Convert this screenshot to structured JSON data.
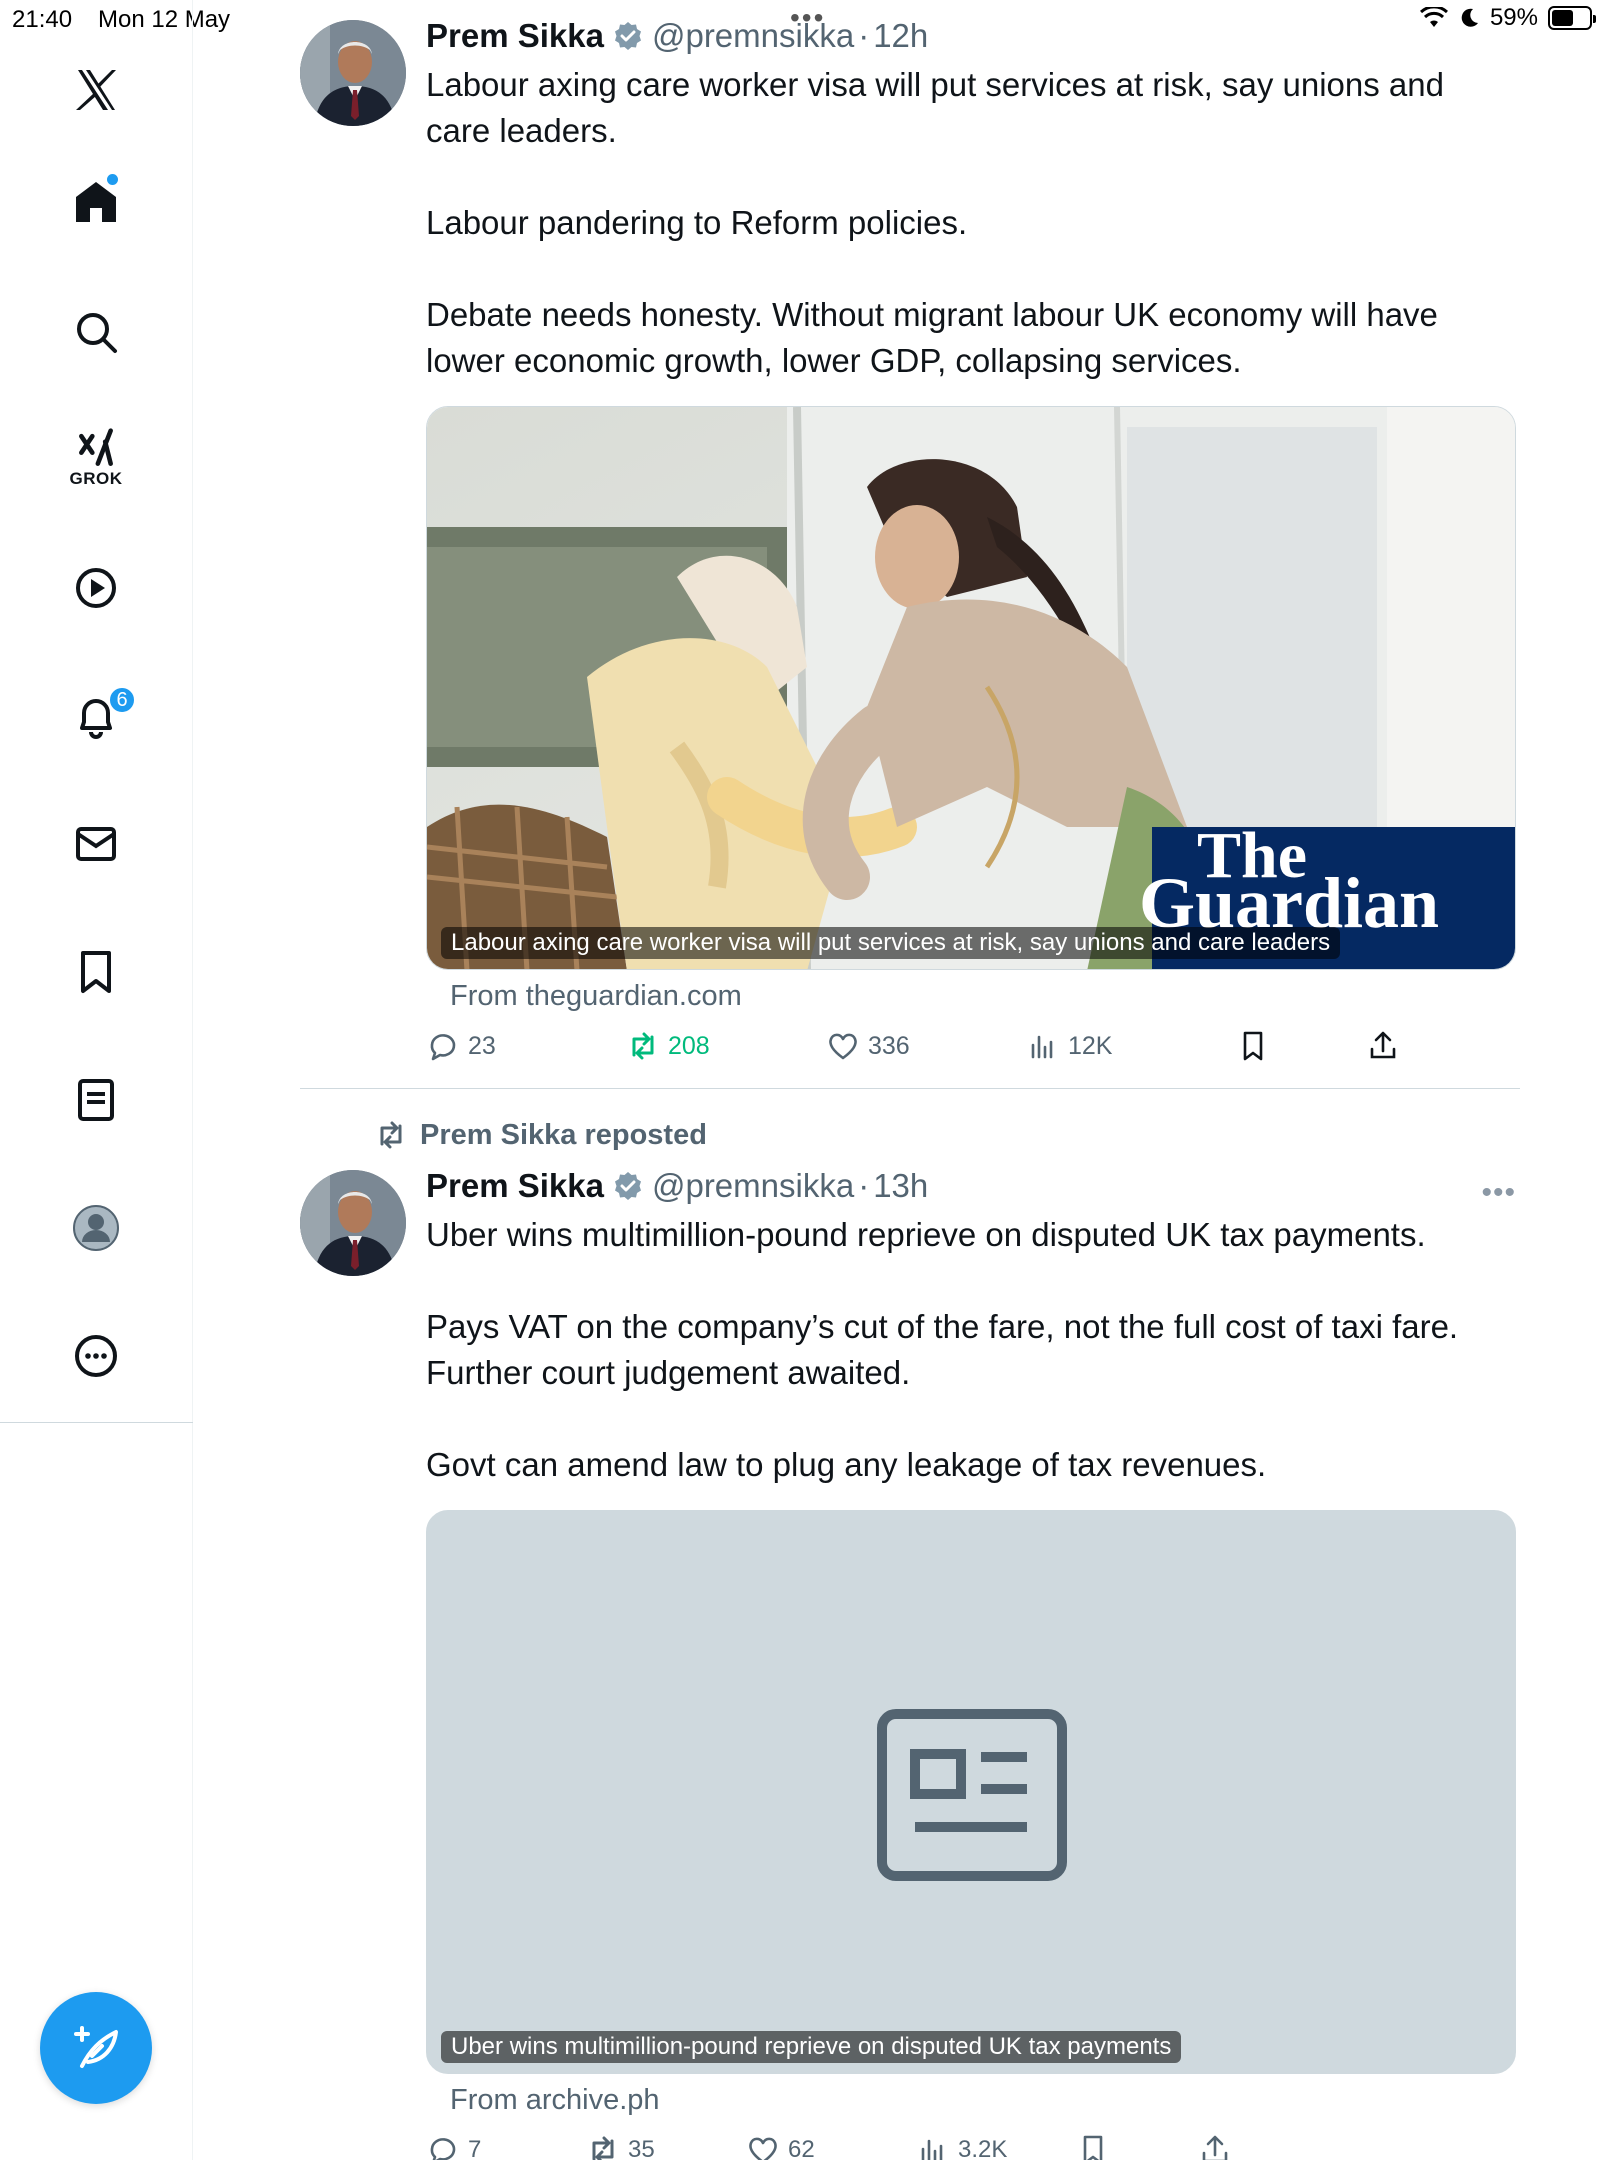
{
  "status_bar": {
    "time": "21:40",
    "date": "Mon 12 May",
    "battery": "59%",
    "battery_level": 0.59
  },
  "sidebar": {
    "grok_label": "GROK",
    "notifications_badge": "6",
    "items": [
      {
        "name": "x-logo",
        "icon": "x-logo-icon"
      },
      {
        "name": "home",
        "icon": "home-icon"
      },
      {
        "name": "explore",
        "icon": "search-icon"
      },
      {
        "name": "grok",
        "icon": "grok-icon"
      },
      {
        "name": "video",
        "icon": "play-icon"
      },
      {
        "name": "notifications",
        "icon": "bell-icon"
      },
      {
        "name": "messages",
        "icon": "envelope-icon"
      },
      {
        "name": "bookmarks",
        "icon": "bookmark-icon"
      },
      {
        "name": "lists",
        "icon": "list-icon"
      },
      {
        "name": "profile",
        "icon": "profile-icon"
      },
      {
        "name": "more",
        "icon": "more-circle-icon"
      }
    ]
  },
  "tweets": [
    {
      "author": "Prem Sikka",
      "handle": "@premnsikka",
      "separator": "·",
      "time": "12h",
      "paragraphs": [
        "Labour axing care worker visa will put services at risk, say unions and care leaders.",
        "Labour pandering to Reform policies.",
        "Debate needs honesty. Without migrant labour UK economy will have lower economic growth, lower GDP, collapsing services."
      ],
      "card": {
        "caption": "Labour axing care worker visa will put services at risk, say unions and care leaders",
        "source": "From theguardian.com",
        "brand_line1": "The",
        "brand_line2": "Guardian",
        "brand_color": "#052962"
      },
      "stats": {
        "replies": "23",
        "reposts": "208",
        "likes": "336",
        "views": "12K"
      }
    },
    {
      "repost_label": "Prem Sikka reposted",
      "author": "Prem Sikka",
      "handle": "@premnsikka",
      "separator": "·",
      "time": "13h",
      "paragraphs": [
        "Uber wins multimillion-pound reprieve on disputed UK tax payments.",
        "Pays VAT on the company’s cut of the fare, not the full cost of taxi fare. Further court judgement awaited.",
        "Govt can amend law to plug any leakage of tax revenues."
      ],
      "card": {
        "caption": "Uber wins multimillion-pound reprieve on disputed UK tax payments",
        "source": "From archive.ph",
        "placeholder_icon": "article-icon"
      },
      "stats": {
        "replies": "7",
        "reposts": "35",
        "likes": "62",
        "views": "3.2K"
      }
    }
  ],
  "colors": {
    "accent": "#1d9bf0",
    "retweet_green": "#00ba7c",
    "muted": "#536471"
  }
}
